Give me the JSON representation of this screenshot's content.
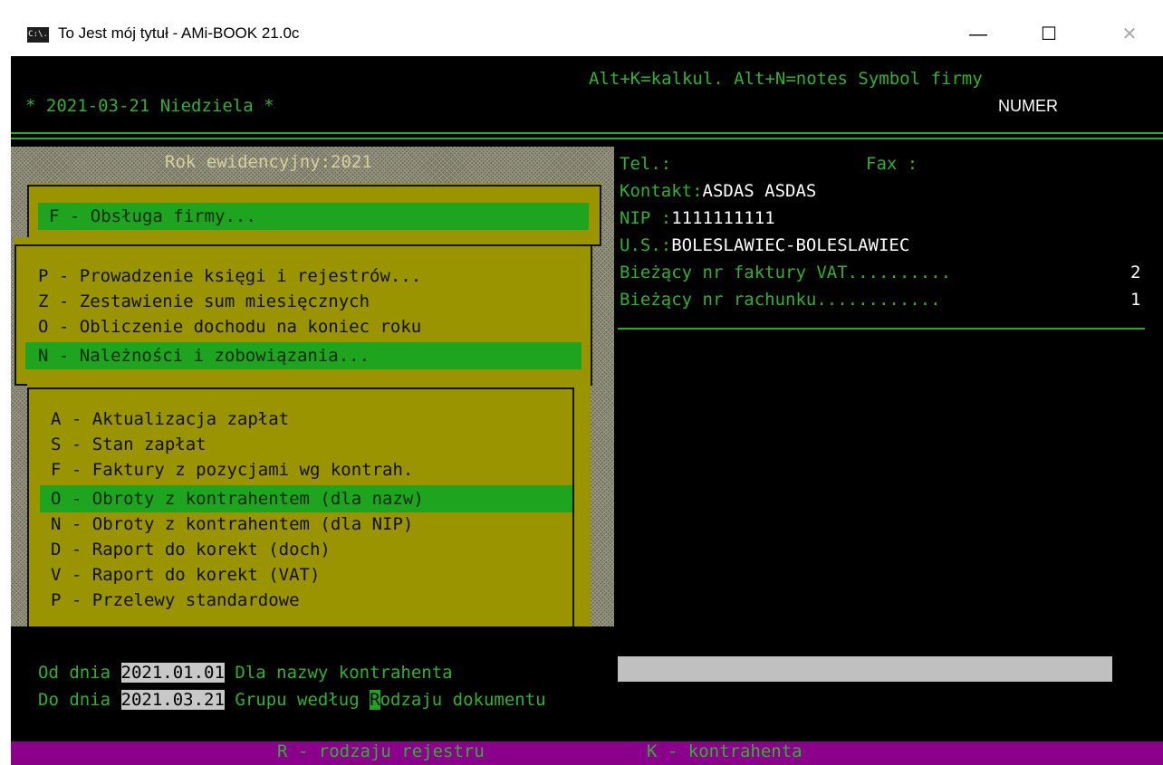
{
  "window": {
    "icon_text": "C:\\.",
    "title": "To Jest mój tytuł - AMi-BOOK 21.0c",
    "minimize": "—",
    "maximize": "☐",
    "close": "✕"
  },
  "header": {
    "hotkeys": "Alt+K=kalkul. Alt+N=notes Symbol firmy",
    "date": "* 2021-03-21 Niedziela *",
    "company_symbol": "NUMER"
  },
  "menu": {
    "year_label": "Rok ewidencyjny:2021",
    "level1": [
      "F - Obsługa firmy..."
    ],
    "level2": [
      "P - Prowadzenie księgi i rejestrów...",
      "Z - Zestawienie sum miesięcznych",
      "O - Obliczenie dochodu na koniec roku",
      "N - Należności i zobowiązania..."
    ],
    "level3": [
      "A - Aktualizacja zapłat",
      "S - Stan zapłat",
      "F - Faktury z pozycjami wg kontrah.",
      "O - Obroty z kontrahentem (dla nazw)",
      "N - Obroty z kontrahentem (dla NIP)",
      "D - Raport do korekt (doch)",
      "V - Raport do korekt (VAT)",
      "P - Przelewy standardowe"
    ]
  },
  "info": {
    "tel_label": "Tel.:",
    "fax_label": "Fax :",
    "contact_label": "Kontakt:",
    "contact_value": "ASDAS ASDAS",
    "nip_label": "NIP :",
    "nip_value": "1111111111",
    "us_label": "U.S.:",
    "us_value": "BOLESLAWIEC-BOLESLAWIEC",
    "vat_invoice_label": "Bieżący nr faktury VAT..........",
    "vat_invoice_value": "2",
    "bill_label": "Bieżący nr rachunku............",
    "bill_value": "1"
  },
  "form": {
    "from_label": "Od dnia",
    "from_value": "2021.01.01",
    "name_label": "Dla nazwy kontrahenta",
    "name_value": "",
    "to_label": "Do dnia",
    "to_value": "2021.03.21",
    "group_prefix": "Grupu według",
    "group_cursor": "R",
    "group_rest": "odzaju dokumentu"
  },
  "footer": {
    "option_r": "R - rodzaju rejestru",
    "option_k": "K - kontrahenta"
  },
  "colors": {
    "console_bg": "#000000",
    "text_green": "#33b033",
    "menu_bg": "#9a9400",
    "highlight": "#1ea41e",
    "footer_bg": "#8a008a"
  }
}
